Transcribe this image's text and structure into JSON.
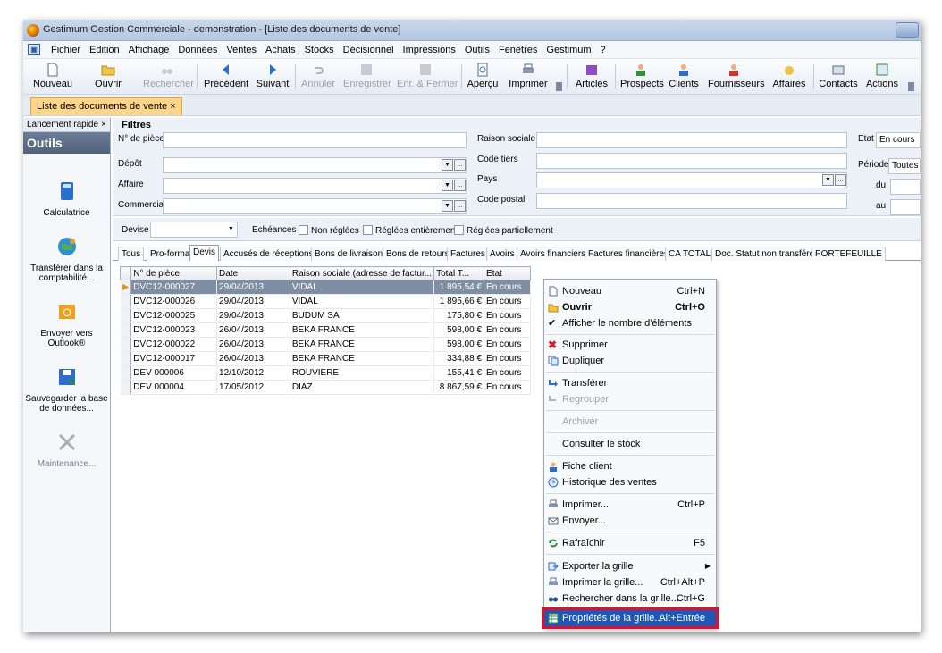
{
  "window": {
    "title": "Gestimum Gestion Commerciale - demonstration - [Liste des documents de vente]"
  },
  "menubar": {
    "items": [
      "Fichier",
      "Edition",
      "Affichage",
      "Données",
      "Ventes",
      "Achats",
      "Stocks",
      "Décisionnel",
      "Impressions",
      "Outils",
      "Fenêtres",
      "Gestimum",
      "?"
    ]
  },
  "toolbar": {
    "nouveau": "Nouveau",
    "ouvrir": "Ouvrir",
    "rechercher": "Rechercher",
    "precedent": "Précédent",
    "suivant": "Suivant",
    "annuler": "Annuler",
    "enregistrer": "Enregistrer",
    "enr_fermer": "Enr. & Fermer",
    "apercu": "Aperçu",
    "imprimer": "Imprimer",
    "articles": "Articles",
    "prospects": "Prospects",
    "clients": "Clients",
    "fournisseurs": "Fournisseurs",
    "affaires": "Affaires",
    "contacts": "Contacts",
    "actions": "Actions"
  },
  "doctab": {
    "label": "Liste des documents de vente",
    "close": "×"
  },
  "leftpanel": {
    "header": "Lancement rapide",
    "close": "×",
    "section": "Outils",
    "items": [
      "Calculatrice",
      "Transférer dans la comptabilité...",
      "Envoyer vers Outlook®",
      "Sauvegarder la base de données...",
      "Maintenance..."
    ]
  },
  "filters": {
    "title": "Filtres",
    "num_piece": "N° de pièce",
    "depot": "Dépôt",
    "affaire": "Affaire",
    "commercial": "Commercial",
    "raison_sociale": "Raison sociale",
    "code_tiers": "Code tiers",
    "pays": "Pays",
    "code_postal": "Code postal",
    "etat": "Etat",
    "etat_value": "En cours",
    "periode": "Période",
    "periode_value": "Toutes",
    "du": "du",
    "au": "au",
    "devise": "Devise",
    "echeances": "Echéances",
    "non_reglees": "Non réglées",
    "reglees_entierement": "Réglées entièrement",
    "reglees_partiellement": "Réglées partiellement"
  },
  "gridtabs": [
    "Tous",
    "Pro-forma",
    "Devis",
    "Accusés de réceptions",
    "Bons de livraisons",
    "Bons de retours",
    "Factures",
    "Avoirs",
    "Avoirs financiers",
    "Factures financières",
    "CA TOTAL",
    "Doc. Statut non transféré",
    "PORTEFEUILLE"
  ],
  "grid": {
    "columns": [
      "N° de pièce",
      "Date",
      "Raison sociale (adresse de factur...",
      "Total T...",
      "Etat"
    ],
    "rows": [
      {
        "num": "DVC12-000027",
        "date": "29/04/2013",
        "raison": "VIDAL",
        "total": "1 895,54 €",
        "etat": "En cours"
      },
      {
        "num": "DVC12-000026",
        "date": "29/04/2013",
        "raison": "VIDAL",
        "total": "1 895,66 €",
        "etat": "En cours"
      },
      {
        "num": "DVC12-000025",
        "date": "29/04/2013",
        "raison": "BUDUM SA",
        "total": "175,80 €",
        "etat": "En cours"
      },
      {
        "num": "DVC12-000023",
        "date": "26/04/2013",
        "raison": "BEKA FRANCE",
        "total": "598,00 €",
        "etat": "En cours"
      },
      {
        "num": "DVC12-000022",
        "date": "26/04/2013",
        "raison": "BEKA FRANCE",
        "total": "598,00 €",
        "etat": "En cours"
      },
      {
        "num": "DVC12-000017",
        "date": "26/04/2013",
        "raison": "BEKA FRANCE",
        "total": "334,88 €",
        "etat": "En cours"
      },
      {
        "num": "DEV 000006",
        "date": "12/10/2012",
        "raison": "ROUVIERE",
        "total": "155,41 €",
        "etat": "En cours"
      },
      {
        "num": "DEV 000004",
        "date": "17/05/2012",
        "raison": "DIAZ",
        "total": "8 867,59 €",
        "etat": "En cours"
      }
    ]
  },
  "contextmenu": {
    "nouveau": {
      "label": "Nouveau",
      "key": "Ctrl+N"
    },
    "ouvrir": {
      "label": "Ouvrir",
      "key": "Ctrl+O"
    },
    "afficher_nb": {
      "label": "Afficher le nombre d'éléments"
    },
    "supprimer": {
      "label": "Supprimer"
    },
    "dupliquer": {
      "label": "Dupliquer"
    },
    "transferer": {
      "label": "Transférer"
    },
    "regrouper": {
      "label": "Regrouper"
    },
    "archiver": {
      "label": "Archiver"
    },
    "consulter_stock": {
      "label": "Consulter le stock"
    },
    "fiche_client": {
      "label": "Fiche client"
    },
    "historique": {
      "label": "Historique des ventes"
    },
    "imprimer": {
      "label": "Imprimer...",
      "key": "Ctrl+P"
    },
    "envoyer": {
      "label": "Envoyer..."
    },
    "rafraichir": {
      "label": "Rafraîchir",
      "key": "F5"
    },
    "exporter": {
      "label": "Exporter la grille"
    },
    "imprimer_grille": {
      "label": "Imprimer la grille...",
      "key": "Ctrl+Alt+P"
    },
    "rechercher_grille": {
      "label": "Rechercher dans la grille...",
      "key": "Ctrl+G"
    },
    "proprietes": {
      "label": "Propriétés de la grille...",
      "key": "Alt+Entrée"
    }
  },
  "colors": {
    "highlight": "#1d58b8",
    "callout": "#e0102a",
    "selection_row": "#7e8ea4",
    "doctab": "#ffd58a"
  }
}
